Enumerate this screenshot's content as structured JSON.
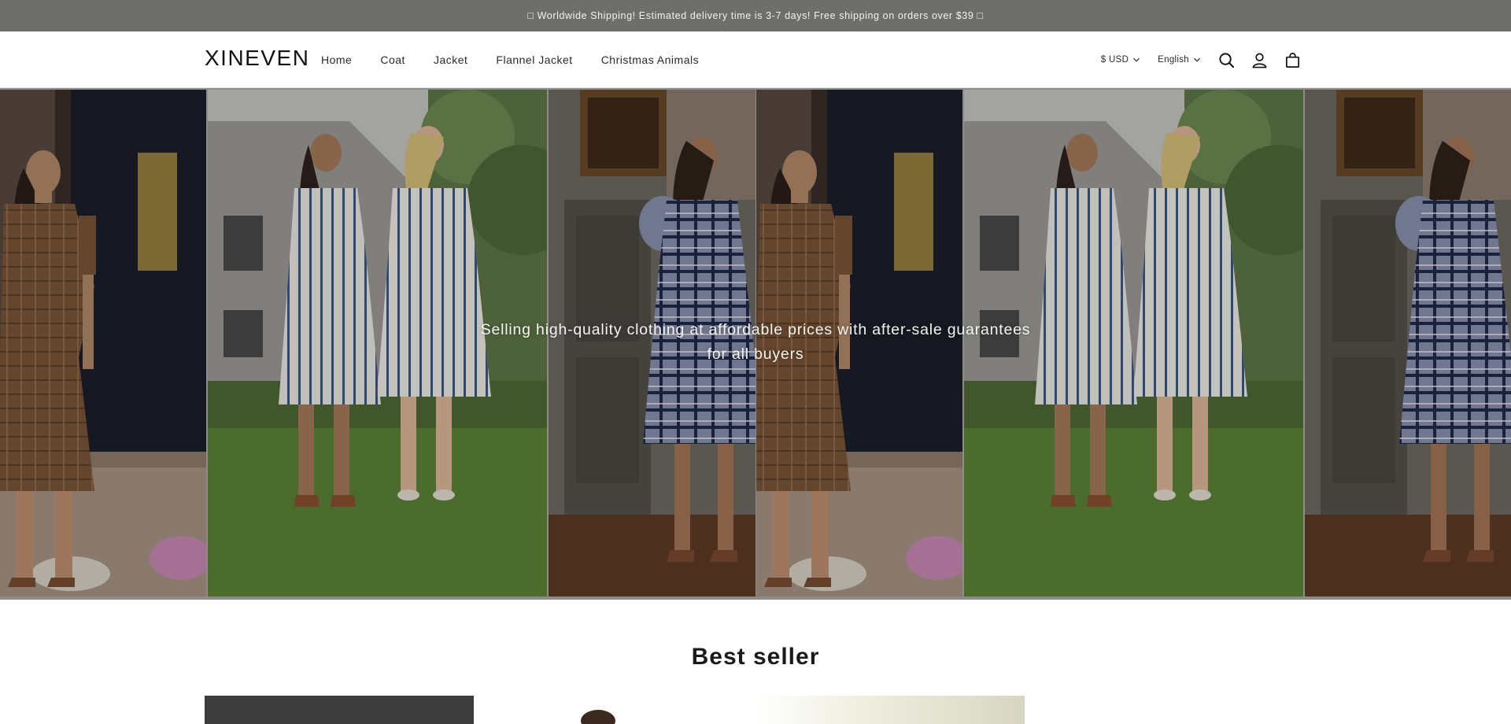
{
  "announcement": {
    "text": "□ Worldwide Shipping! Estimated delivery time is 3-7 days! Free shipping on orders over $39 □"
  },
  "header": {
    "logo": "XINEVEN",
    "nav": [
      "Home",
      "Coat",
      "Jacket",
      "Flannel Jacket",
      "Christmas Animals"
    ],
    "currency": "$ USD",
    "language": "English",
    "icons": [
      "search-icon",
      "account-icon",
      "cart-icon"
    ]
  },
  "hero": {
    "caption": "Selling high-quality clothing at affordable prices with after-sale guarantees for all buyers",
    "images": [
      "woman-in-brown-plaid-dress-at-doorway",
      "two-women-in-floral-striped-dresses-on-lawn",
      "woman-in-navy-plaid-puff-sleeve-dress-indoors"
    ]
  },
  "best_seller": {
    "title": "Best seller"
  },
  "colors": {
    "announcement_bg": "#6e6e6a",
    "text": "#121212",
    "background": "#ffffff"
  }
}
